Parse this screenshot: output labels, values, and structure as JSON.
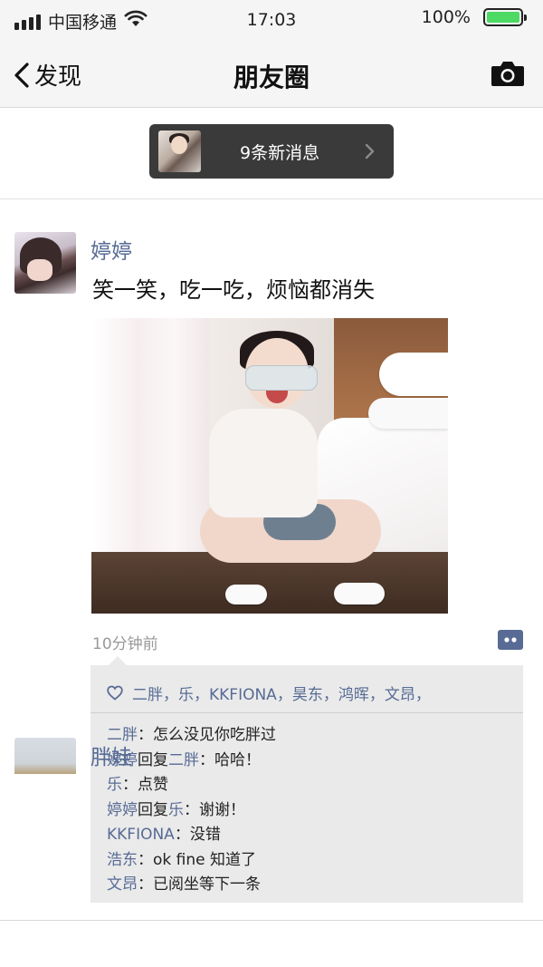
{
  "status_bar": {
    "carrier": "中国移通",
    "time": "17:03",
    "battery_percent": "100%",
    "battery_color": "#4cd964"
  },
  "nav": {
    "back_label": "发现",
    "title": "朋友圈",
    "camera_icon": "camera-icon"
  },
  "notice": {
    "text": "9条新消息",
    "arrow_icon": "chevron-right-icon"
  },
  "post": {
    "author": "婷婷",
    "text": "笑一笑，吃一吃，烦恼都消失",
    "time_ago": "10分钟前",
    "comment_icon": "comment-icon",
    "likes_icon": "heart-icon",
    "likes": "二胖，乐，KKFIONA，昊东，鸿晖，文昂，",
    "comments": [
      {
        "name": "二胖",
        "reply_to": "",
        "text": "怎么没见你吃胖过"
      },
      {
        "name": "婷婷",
        "reply_to": "二胖",
        "text": "哈哈！"
      },
      {
        "name": "乐",
        "reply_to": "",
        "text": "点赞"
      },
      {
        "name": "婷婷",
        "reply_to": "乐",
        "text": "谢谢！"
      },
      {
        "name": "KKFIONA",
        "reply_to": "",
        "text": "没错"
      },
      {
        "name": "浩东",
        "reply_to": "",
        "text": "ok fine 知道了"
      },
      {
        "name": "文昂",
        "reply_to": "",
        "text": "已阅坐等下一条"
      }
    ],
    "reply_word": "回复",
    "colon": "："
  },
  "next_post": {
    "author": "胖娃"
  },
  "colors": {
    "link_blue": "#576b95",
    "nav_bg": "#f5f5f5",
    "comment_bg": "#eaeaea",
    "notice_bg": "#3a3a3a"
  }
}
